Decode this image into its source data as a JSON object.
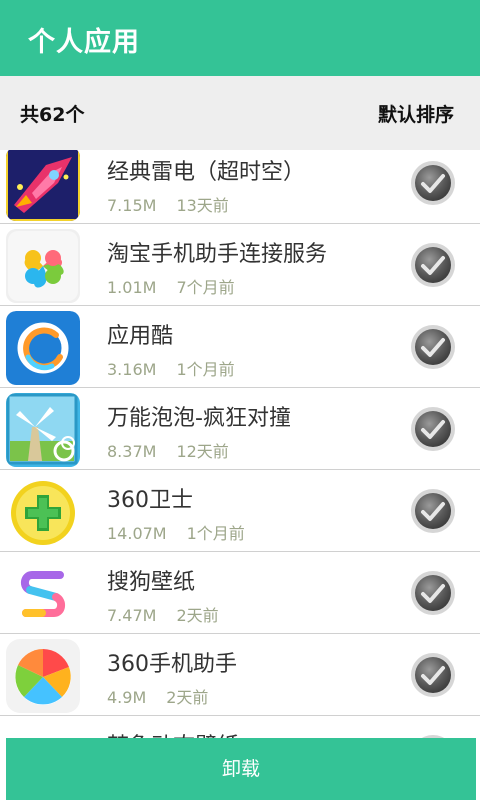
{
  "header": {
    "title": "个人应用"
  },
  "summary": {
    "count_label": "共62个",
    "sort_label": "默认排序"
  },
  "apps": [
    {
      "name": "经典雷电（超时空）",
      "size": "7.15M",
      "date": "13天前",
      "icon": "fighter-jet-game-icon",
      "checked": true
    },
    {
      "name": "淘宝手机助手连接服务",
      "size": "1.01M",
      "date": "7个月前",
      "icon": "four-leaf-clover-icon",
      "checked": true
    },
    {
      "name": "应用酷",
      "size": "3.16M",
      "date": "1个月前",
      "icon": "blue-swirl-icon",
      "checked": true
    },
    {
      "name": "万能泡泡-疯狂对撞",
      "size": "8.37M",
      "date": "12天前",
      "icon": "windmill-bubble-icon",
      "checked": true
    },
    {
      "name": " 360卫士",
      "size": "14.07M",
      "date": "1个月前",
      "icon": "green-plus-shield-icon",
      "checked": true
    },
    {
      "name": "搜狗壁纸",
      "size": "7.47M",
      "date": "2天前",
      "icon": "colorful-s-icon",
      "checked": true
    },
    {
      "name": "360手机助手",
      "size": "4.9M",
      "date": "2天前",
      "icon": "colorful-pie-icon",
      "checked": true
    },
    {
      "name": "梦象动态壁纸",
      "size": "",
      "date": "",
      "icon": "partial-icon",
      "checked": true
    }
  ],
  "footer": {
    "uninstall_label": "卸载"
  },
  "colors": {
    "accent": "#34c396",
    "meta_text": "#9da68a",
    "summary_bg": "#eeeeee"
  }
}
